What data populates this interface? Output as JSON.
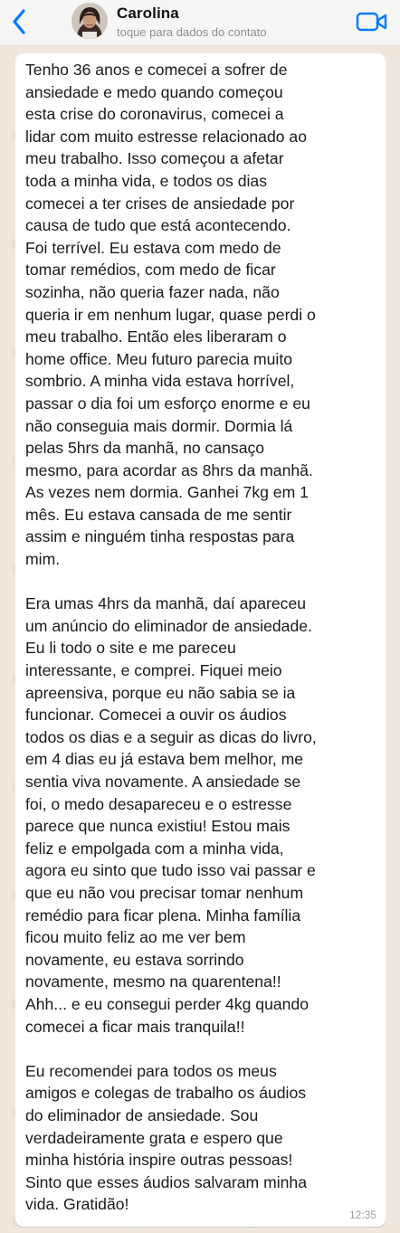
{
  "header": {
    "back_icon": "chevron-left-icon",
    "contact_name": "Carolina",
    "contact_subtitle": "toque para dados do contato",
    "video_icon": "video-camera-icon",
    "accent_color": "#007aff"
  },
  "message": {
    "paragraphs": [
      [
        "Tenho 36 anos e comecei a sofrer de",
        "ansiedade e medo quando começou",
        "esta crise do coronavirus, comecei a",
        "lidar com muito estresse relacionado ao",
        "meu trabalho. Isso começou a afetar",
        "toda a minha vida, e todos os dias",
        "comecei a ter crises de ansiedade por",
        "causa de tudo que está acontecendo.",
        "Foi terrível. Eu estava com medo de",
        "tomar remédios, com medo de ficar",
        "sozinha, não queria fazer nada, não",
        "queria ir em nenhum lugar, quase perdi o",
        "meu trabalho. Então eles liberaram o",
        "home office. Meu futuro parecia muito",
        "sombrio. A minha vida estava horrível,",
        "passar o dia foi um esforço enorme e eu",
        "não conseguia mais dormir. Dormia lá",
        "pelas 5hrs da manhã, no cansaço",
        "mesmo, para acordar as 8hrs da manhã.",
        "As vezes nem dormia. Ganhei 7kg em 1",
        "mês. Eu estava cansada de me sentir",
        "assim e ninguém tinha respostas para",
        "mim."
      ],
      [
        "Era umas 4hrs da manhã, daí apareceu",
        "um anúncio do eliminador de ansiedade.",
        "Eu li todo o site e me pareceu",
        "interessante, e comprei. Fiquei meio",
        "apreensiva, porque eu não sabia se ia",
        "funcionar. Comecei a ouvir os áudios",
        "todos os dias e a seguir as dicas do livro,",
        "em 4 dias eu já estava bem melhor, me",
        "sentia viva novamente. A ansiedade se",
        "foi, o medo desapareceu e o estresse",
        "parece que nunca existiu! Estou mais",
        "feliz e empolgada com a minha vida,",
        "agora eu sinto que tudo isso vai passar e",
        "que eu não vou precisar tomar nenhum",
        "remédio para ficar plena. Minha família",
        "ficou muito feliz ao me ver bem",
        "novamente, eu estava sorrindo",
        "novamente, mesmo na quarentena!!",
        "Ahh... e eu consegui perder 4kg quando",
        "comecei a ficar mais tranquila!!"
      ],
      [
        "Eu recomendei para todos os meus",
        "amigos e colegas de trabalho os áudios",
        "do eliminador de ansiedade. Sou",
        "verdadeiramente grata e espero que",
        "minha história inspire outras pessoas!",
        "Sinto que esses áudios salvaram minha",
        "vida. Gratidão!"
      ]
    ],
    "time": "12:35"
  }
}
